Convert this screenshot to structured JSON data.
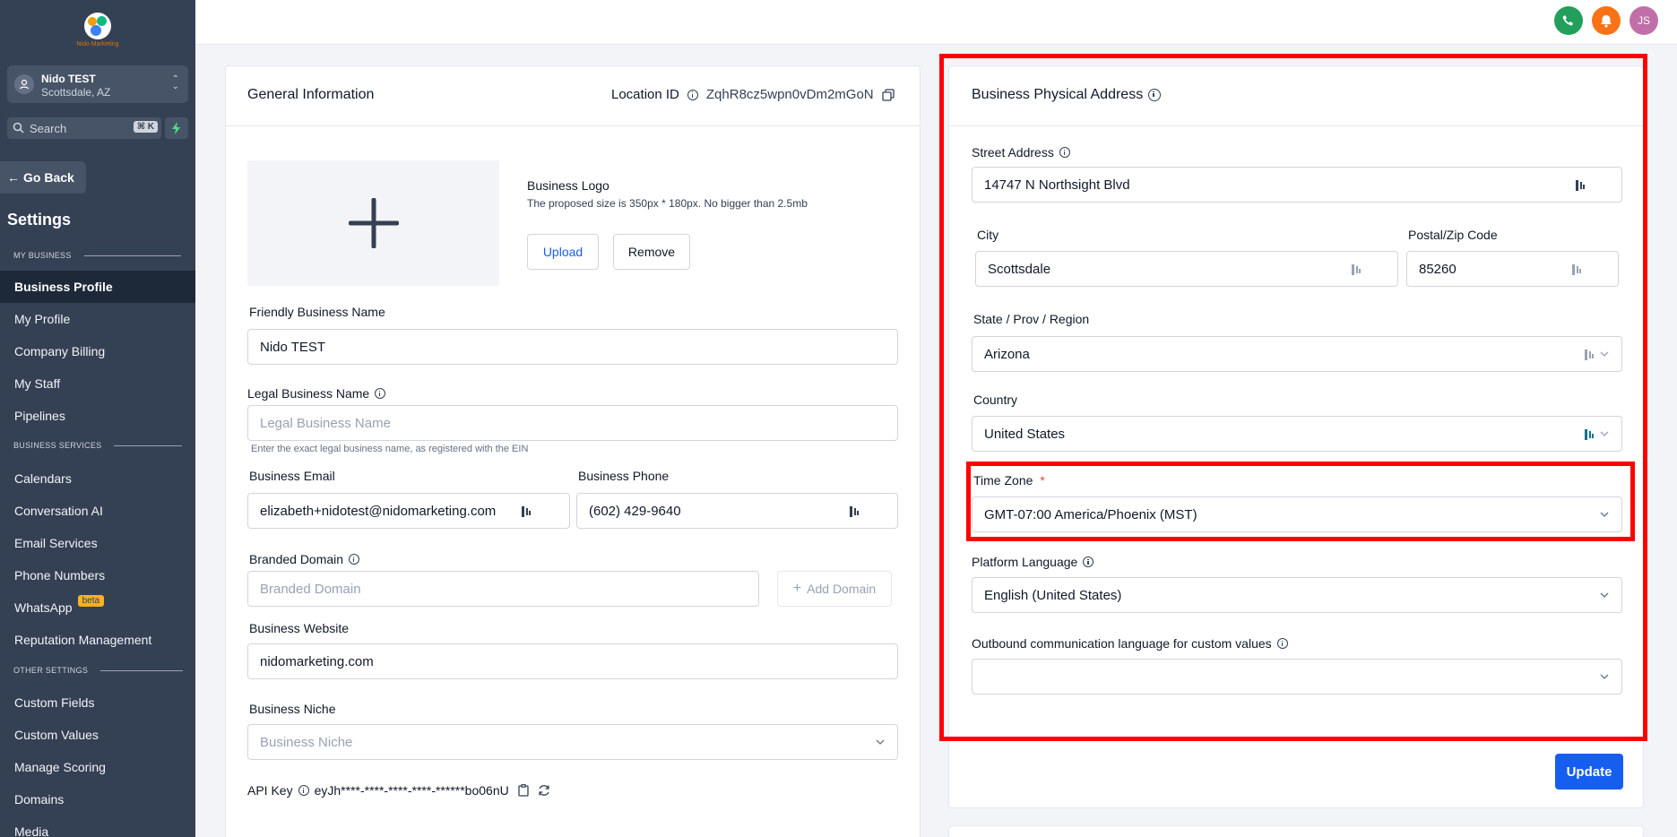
{
  "sidebar": {
    "brand_text": "Nido Marketing",
    "location": {
      "name": "Nido TEST",
      "address": "Scottsdale, AZ"
    },
    "search": {
      "placeholder": "Search",
      "shortcut": "⌘ K"
    },
    "go_back": "Go Back",
    "title": "Settings",
    "sections": {
      "my_business": "MY BUSINESS",
      "business_services": "BUSINESS SERVICES",
      "other_settings": "OTHER SETTINGS"
    },
    "items": [
      {
        "label": "Business Profile",
        "active": true
      },
      {
        "label": "My Profile"
      },
      {
        "label": "Company Billing"
      },
      {
        "label": "My Staff"
      },
      {
        "label": "Pipelines"
      },
      {
        "label": "Calendars"
      },
      {
        "label": "Conversation AI"
      },
      {
        "label": "Email Services"
      },
      {
        "label": "Phone Numbers"
      },
      {
        "label": "WhatsApp",
        "badge": "beta"
      },
      {
        "label": "Reputation Management"
      },
      {
        "label": "Custom Fields"
      },
      {
        "label": "Custom Values"
      },
      {
        "label": "Manage Scoring"
      },
      {
        "label": "Domains"
      },
      {
        "label": "Media"
      }
    ]
  },
  "topbar": {
    "user_initials": "JS",
    "colors": {
      "phone": "#22a05b",
      "bell": "#f97316",
      "avatar": "#c06fa8"
    }
  },
  "general": {
    "title": "General Information",
    "location_id_label": "Location ID",
    "location_id_value": "ZqhR8cz5wpn0vDm2mGoN",
    "logo": {
      "title": "Business Logo",
      "hint": "The proposed size is 350px * 180px. No bigger than 2.5mb",
      "upload": "Upload",
      "remove": "Remove"
    },
    "friendly_name": {
      "label": "Friendly Business Name",
      "value": "Nido TEST"
    },
    "legal_name": {
      "label": "Legal Business Name",
      "placeholder": "Legal Business Name",
      "help": "Enter the exact legal business name, as registered with the EIN"
    },
    "email": {
      "label": "Business Email",
      "value": "elizabeth+nidotest@nidomarketing.com"
    },
    "phone": {
      "label": "Business Phone",
      "value": "(602) 429-9640"
    },
    "branded_domain": {
      "label": "Branded Domain",
      "placeholder": "Branded Domain",
      "add": "Add Domain"
    },
    "website": {
      "label": "Business Website",
      "value": "nidomarketing.com"
    },
    "niche": {
      "label": "Business Niche",
      "placeholder": "Business Niche"
    },
    "api_key": {
      "label": "API Key",
      "value": "eyJh****-****-****-****-******bo06nU"
    }
  },
  "address": {
    "title": "Business Physical Address",
    "street": {
      "label": "Street Address",
      "value": "14747 N Northsight Blvd"
    },
    "city": {
      "label": "City",
      "value": "Scottsdale"
    },
    "zip": {
      "label": "Postal/Zip Code",
      "value": "85260"
    },
    "state": {
      "label": "State / Prov / Region",
      "value": "Arizona"
    },
    "country": {
      "label": "Country",
      "value": "United States"
    },
    "timezone": {
      "label": "Time Zone",
      "required": "*",
      "value": "GMT-07:00 America/Phoenix (MST)"
    },
    "language": {
      "label": "Platform Language",
      "value": "English (United States)"
    },
    "outbound": {
      "label": "Outbound communication language for custom values",
      "value": ""
    },
    "update": "Update"
  },
  "colors": {
    "accent": "#155eef",
    "highlight": "#ff0000",
    "sidebar_bg": "#344054"
  }
}
